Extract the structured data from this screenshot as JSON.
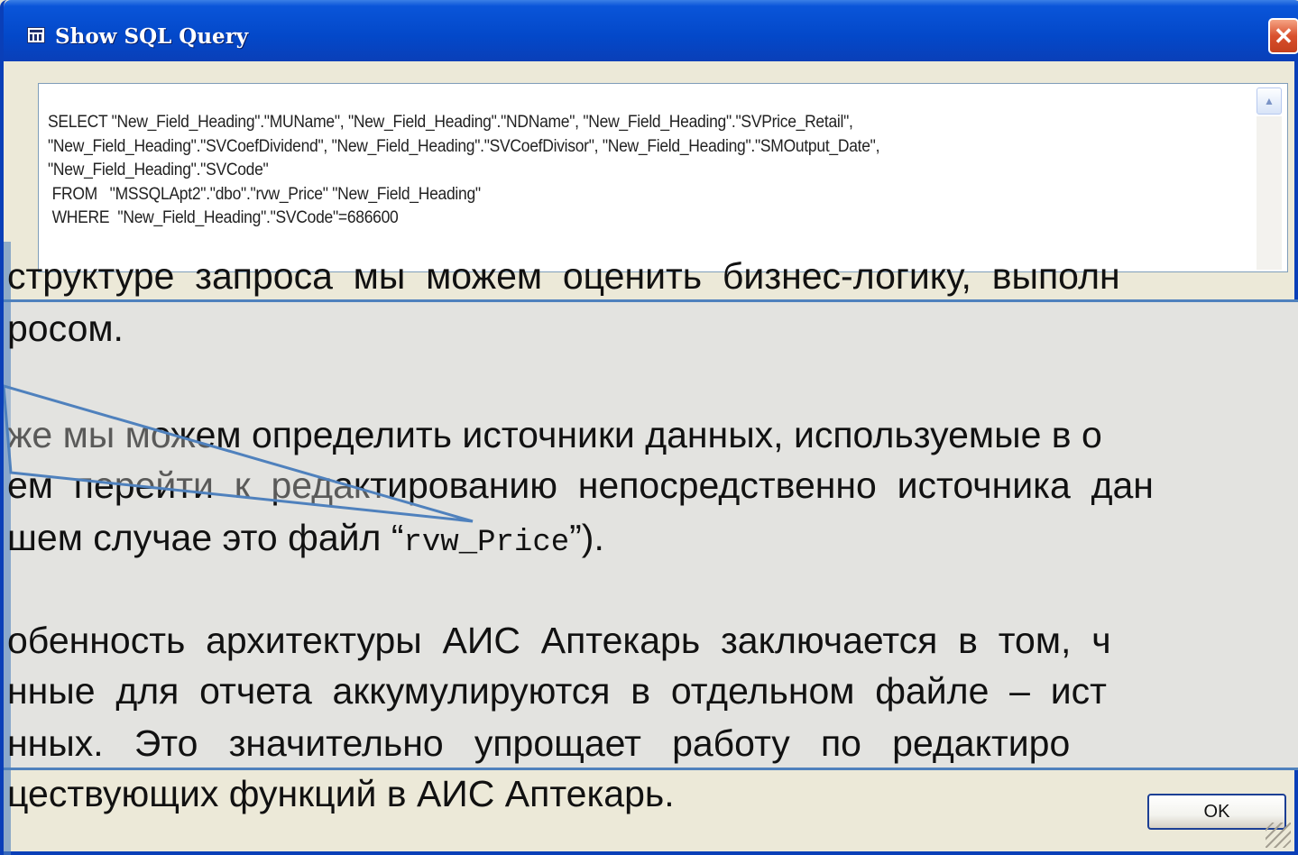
{
  "window": {
    "title": "Show SQL Query",
    "close_glyph": "✕"
  },
  "sql": {
    "lines": [
      "SELECT \"New_Field_Heading\".\"MUName\", \"New_Field_Heading\".\"NDName\", \"New_Field_Heading\".\"SVPrice_Retail\",",
      "\"New_Field_Heading\".\"SVCoefDividend\", \"New_Field_Heading\".\"SVCoefDivisor\", \"New_Field_Heading\".\"SMOutput_Date\",",
      "\"New_Field_Heading\".\"SVCode\"",
      " FROM   \"MSSQLApt2\".\"dbo\".\"rvw_Price\" \"New_Field_Heading\"",
      " WHERE  \"New_Field_Heading\".\"SVCode\"=686600"
    ],
    "scroll_up_glyph": "▲"
  },
  "slide": {
    "line1": "структуре  запроса  мы  можем  оценить  бизнес-логику,  выполн",
    "line2": "росом.",
    "line3": "же мы можем определить источники данных, используемые в о",
    "line4": "ем  перейти  к  редактированию  непосредственно  источника  дан",
    "line5_prefix": "шем случае это файл “",
    "line5_code": "rvw_Price",
    "line5_suffix": "”).",
    "line6": "обенность  архитектуры  АИС  Аптекарь  заключается  в  том,  ч",
    "line7": "нные  для  отчета  аккумулируются  в  отдельном  файле  –  ист",
    "line8": "нных.   Это   значительно   упрощает   работу   по   редактиро",
    "line9": "цествующих функций в АИС Аптекарь."
  },
  "buttons": {
    "ok_label": "OK"
  },
  "colors": {
    "titlebar": "#0348c9",
    "accent": "#4f81bd",
    "close": "#d9502d"
  }
}
